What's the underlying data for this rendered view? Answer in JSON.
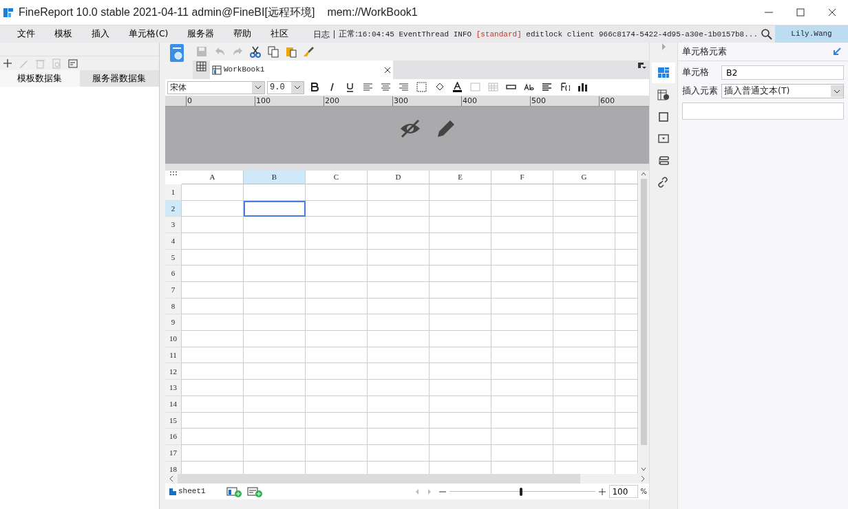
{
  "window": {
    "title": "FineReport 10.0 stable 2021-04-11 admin@FineBI[远程环境]",
    "path": "mem://WorkBook1"
  },
  "menu": {
    "items": [
      "文件",
      "模板",
      "插入",
      "单元格(C)",
      "服务器",
      "帮助",
      "社区"
    ],
    "log_label": "日志",
    "log_status": "正常:",
    "log_text": "16:04:45 EventThread INFO ",
    "log_tag": "[standard]",
    "log_rest": " editlock client 966c8174-5422-4d95-a30e-1b0157b8...",
    "user": "Lily.Wang"
  },
  "left_panel": {
    "tabs": [
      {
        "label": "模板数据集",
        "selected": false
      },
      {
        "label": "服务器数据集",
        "selected": true
      }
    ]
  },
  "file_tabs": [
    {
      "label": "WorkBook1",
      "selected": true
    }
  ],
  "format_bar": {
    "font": "宋体",
    "size": "9.0"
  },
  "ruler": {
    "ticks": [
      "0",
      "100",
      "200",
      "300",
      "400",
      "500",
      "600"
    ]
  },
  "sheet": {
    "columns": [
      {
        "label": "A",
        "selected": false
      },
      {
        "label": "B",
        "selected": true
      },
      {
        "label": "C",
        "selected": false
      },
      {
        "label": "D",
        "selected": false
      },
      {
        "label": "E",
        "selected": false
      },
      {
        "label": "F",
        "selected": false
      },
      {
        "label": "G",
        "selected": false
      }
    ],
    "rows": [
      {
        "label": "1",
        "selected": false
      },
      {
        "label": "2",
        "selected": true
      },
      {
        "label": "3",
        "selected": false
      },
      {
        "label": "4",
        "selected": false
      },
      {
        "label": "5",
        "selected": false
      },
      {
        "label": "6",
        "selected": false
      },
      {
        "label": "7",
        "selected": false
      },
      {
        "label": "8",
        "selected": false
      },
      {
        "label": "9",
        "selected": false
      },
      {
        "label": "10",
        "selected": false
      },
      {
        "label": "11",
        "selected": false
      },
      {
        "label": "12",
        "selected": false
      },
      {
        "label": "13",
        "selected": false
      },
      {
        "label": "14",
        "selected": false
      },
      {
        "label": "15",
        "selected": false
      },
      {
        "label": "16",
        "selected": false
      },
      {
        "label": "17",
        "selected": false
      },
      {
        "label": "18",
        "selected": false
      }
    ]
  },
  "sheet_tabs": [
    {
      "label": "sheet1",
      "selected": true
    }
  ],
  "zoom": {
    "level": 0.49,
    "value": "100",
    "unit": "%"
  },
  "right_panel": {
    "title": "单元格元素",
    "cell_label": "单元格",
    "cell_value": "B2",
    "insert_label": "插入元素",
    "insert_value": "插入普通文本(T)",
    "side_icons": [
      {
        "kind": "cell",
        "selected": true
      },
      {
        "kind": "attr",
        "selected": false
      },
      {
        "kind": "border",
        "selected": false
      },
      {
        "kind": "widget",
        "selected": false
      },
      {
        "kind": "condition",
        "selected": false
      },
      {
        "kind": "link",
        "selected": false
      }
    ]
  }
}
